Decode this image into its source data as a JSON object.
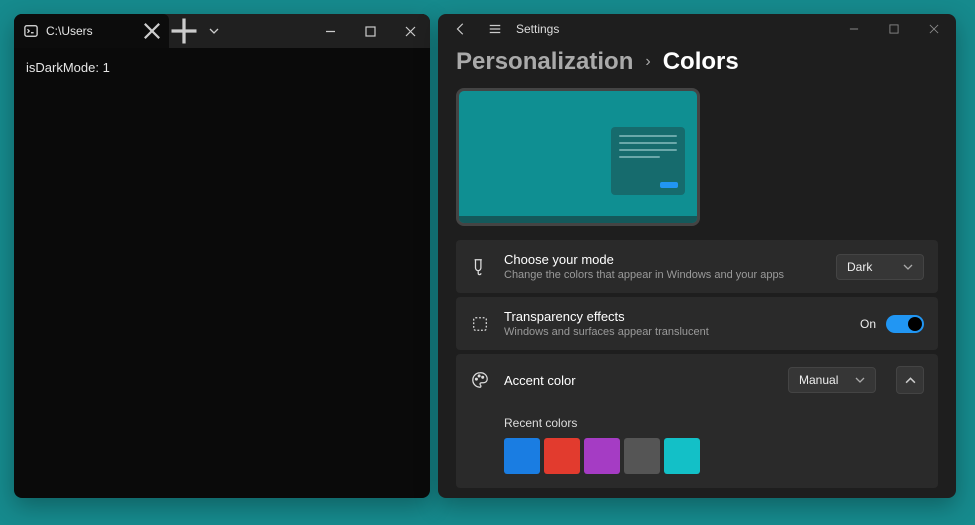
{
  "terminal": {
    "tab_title": "C:\\Users",
    "output": "isDarkMode: 1"
  },
  "settings": {
    "app_title": "Settings",
    "breadcrumb": {
      "parent": "Personalization",
      "current": "Colors"
    },
    "mode_card": {
      "title": "Choose your mode",
      "desc": "Change the colors that appear in Windows and your apps",
      "value": "Dark"
    },
    "transparency_card": {
      "title": "Transparency effects",
      "desc": "Windows and surfaces appear translucent",
      "state_label": "On"
    },
    "accent_card": {
      "title": "Accent color",
      "value": "Manual"
    },
    "recent_colors": {
      "label": "Recent colors",
      "swatches": [
        "#1a7de2",
        "#e23b2e",
        "#a53cc4",
        "#555555",
        "#13c0c7"
      ]
    }
  }
}
